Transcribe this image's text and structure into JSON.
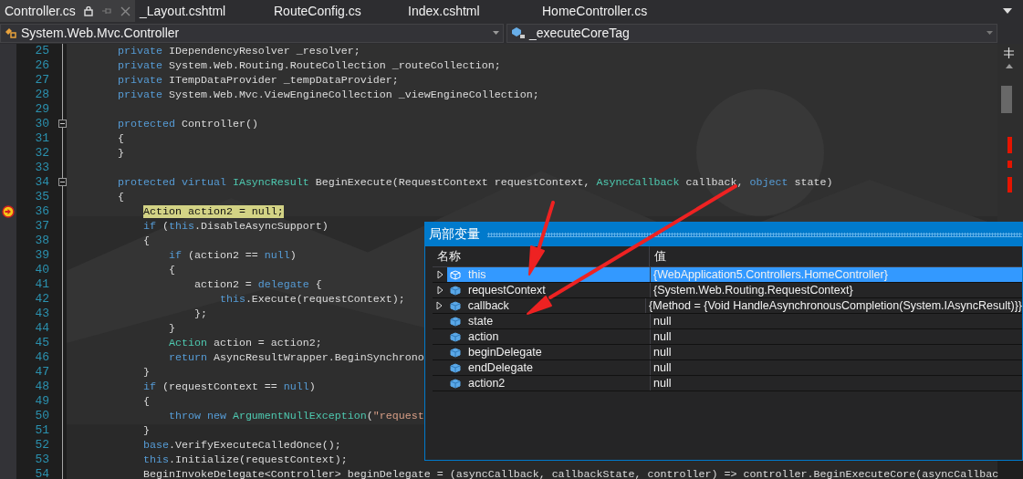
{
  "tabs": [
    {
      "label": "Controller.cs",
      "selected": true
    },
    {
      "label": "_Layout.cshtml",
      "selected": false
    },
    {
      "label": "RouteConfig.cs",
      "selected": false
    },
    {
      "label": "Index.cshtml",
      "selected": false
    },
    {
      "label": "HomeController.cs",
      "selected": false
    }
  ],
  "navigation": {
    "type_combo": "System.Web.Mvc.Controller",
    "member_combo": "_executeCoreTag"
  },
  "editor": {
    "lines": [
      {
        "number": "25",
        "tokens": [
          {
            "kind": "keyword",
            "text": "        private"
          },
          {
            "kind": "plain",
            "text": " IDependencyResolver _resolver;"
          }
        ]
      },
      {
        "number": "26",
        "tokens": [
          {
            "kind": "keyword",
            "text": "        private"
          },
          {
            "kind": "plain",
            "text": " System.Web.Routing.RouteCollection _routeCollection;"
          }
        ]
      },
      {
        "number": "27",
        "tokens": [
          {
            "kind": "keyword",
            "text": "        private"
          },
          {
            "kind": "plain",
            "text": " ITempDataProvider _tempDataProvider;"
          }
        ]
      },
      {
        "number": "28",
        "tokens": [
          {
            "kind": "keyword",
            "text": "        private"
          },
          {
            "kind": "plain",
            "text": " System.Web.Mvc.ViewEngineCollection _viewEngineCollection;"
          }
        ]
      },
      {
        "number": "29"
      },
      {
        "number": "30",
        "expanded": true,
        "tokens": [
          {
            "kind": "keyword",
            "text": "        protected"
          },
          {
            "kind": "plain",
            "text": " Controller()"
          }
        ]
      },
      {
        "number": "31",
        "tokens": [
          {
            "kind": "plain",
            "text": "        {"
          }
        ]
      },
      {
        "number": "32",
        "tokens": [
          {
            "kind": "plain",
            "text": "        }"
          }
        ]
      },
      {
        "number": "33"
      },
      {
        "number": "34",
        "expanded": true,
        "tokens": [
          {
            "kind": "keyword",
            "text": "        protected virtual"
          },
          {
            "kind": "type",
            "text": " IAsyncResult"
          },
          {
            "kind": "plain",
            "text": " BeginExecute(RequestContext requestContext, "
          },
          {
            "kind": "type",
            "text": "AsyncCallback"
          },
          {
            "kind": "plain",
            "text": " callback, "
          },
          {
            "kind": "keyword",
            "text": "object"
          },
          {
            "kind": "plain",
            "text": " state)"
          }
        ]
      },
      {
        "number": "35",
        "tokens": [
          {
            "kind": "plain",
            "text": "        {"
          }
        ]
      },
      {
        "number": "36",
        "current": true,
        "tokens": [
          {
            "kind": "plain",
            "text": "            Action action2 = null;"
          }
        ]
      },
      {
        "number": "37",
        "tokens": [
          {
            "kind": "keyword",
            "text": "            if"
          },
          {
            "kind": "plain",
            "text": " ("
          },
          {
            "kind": "keyword",
            "text": "this"
          },
          {
            "kind": "plain",
            "text": ".DisableAsyncSupport)"
          }
        ]
      },
      {
        "number": "38",
        "tokens": [
          {
            "kind": "plain",
            "text": "            {"
          }
        ]
      },
      {
        "number": "39",
        "tokens": [
          {
            "kind": "keyword",
            "text": "                if"
          },
          {
            "kind": "plain",
            "text": " (action2 == "
          },
          {
            "kind": "keyword",
            "text": "null"
          },
          {
            "kind": "plain",
            "text": ")"
          }
        ]
      },
      {
        "number": "40",
        "tokens": [
          {
            "kind": "plain",
            "text": "                {"
          }
        ]
      },
      {
        "number": "41",
        "tokens": [
          {
            "kind": "plain",
            "text": "                    action2 = "
          },
          {
            "kind": "keyword",
            "text": "delegate"
          },
          {
            "kind": "plain",
            "text": " {"
          }
        ]
      },
      {
        "number": "42",
        "tokens": [
          {
            "kind": "keyword",
            "text": "                        this"
          },
          {
            "kind": "plain",
            "text": ".Execute(requestContext);"
          }
        ]
      },
      {
        "number": "43",
        "tokens": [
          {
            "kind": "plain",
            "text": "                    };"
          }
        ]
      },
      {
        "number": "44",
        "tokens": [
          {
            "kind": "plain",
            "text": "                }"
          }
        ]
      },
      {
        "number": "45",
        "tokens": [
          {
            "kind": "type",
            "text": "                Action"
          },
          {
            "kind": "plain",
            "text": " action = action2;"
          }
        ]
      },
      {
        "number": "46",
        "tokens": [
          {
            "kind": "keyword",
            "text": "                return"
          },
          {
            "kind": "plain",
            "text": " AsyncResultWrapper.BeginSynchrono"
          }
        ]
      },
      {
        "number": "47",
        "tokens": [
          {
            "kind": "plain",
            "text": "            }"
          }
        ]
      },
      {
        "number": "48",
        "tokens": [
          {
            "kind": "keyword",
            "text": "            if"
          },
          {
            "kind": "plain",
            "text": " (requestContext == "
          },
          {
            "kind": "keyword",
            "text": "null"
          },
          {
            "kind": "plain",
            "text": ")"
          }
        ]
      },
      {
        "number": "49",
        "tokens": [
          {
            "kind": "plain",
            "text": "            {"
          }
        ]
      },
      {
        "number": "50",
        "tokens": [
          {
            "kind": "keyword",
            "text": "                throw new"
          },
          {
            "kind": "type",
            "text": " ArgumentNullException"
          },
          {
            "kind": "plain",
            "text": "("
          },
          {
            "kind": "string",
            "text": "\"request"
          }
        ]
      },
      {
        "number": "51",
        "tokens": [
          {
            "kind": "plain",
            "text": "            }"
          }
        ]
      },
      {
        "number": "52",
        "tokens": [
          {
            "kind": "keyword",
            "text": "            base"
          },
          {
            "kind": "plain",
            "text": ".VerifyExecuteCalledOnce();"
          }
        ]
      },
      {
        "number": "53",
        "tokens": [
          {
            "kind": "keyword",
            "text": "            this"
          },
          {
            "kind": "plain",
            "text": ".Initialize(requestContext);"
          }
        ]
      },
      {
        "number": "54",
        "tokens": [
          {
            "kind": "plain",
            "text": "            BeginInvokeDelegate<Controller> beginDelegate = (asyncCallback, callbackState, controller) => controller.BeginExecuteCore(asyncCallbac"
          }
        ]
      }
    ]
  },
  "locals": {
    "title": "局部变量",
    "columns": [
      "名称",
      "值"
    ],
    "rows": [
      {
        "name": "this",
        "value": "{WebApplication5.Controllers.HomeController}",
        "expandable": true,
        "selected": true
      },
      {
        "name": "requestContext",
        "value": "{System.Web.Routing.RequestContext}",
        "expandable": true,
        "selected": false
      },
      {
        "name": "callback",
        "value": "{Method = {Void HandleAsynchronousCompletion(System.IAsyncResult)}}",
        "expandable": true,
        "selected": false
      },
      {
        "name": "state",
        "value": "null",
        "expandable": false,
        "selected": false
      },
      {
        "name": "action",
        "value": "null",
        "expandable": false,
        "selected": false
      },
      {
        "name": "beginDelegate",
        "value": "null",
        "expandable": false,
        "selected": false
      },
      {
        "name": "endDelegate",
        "value": "null",
        "expandable": false,
        "selected": false
      },
      {
        "name": "action2",
        "value": "null",
        "expandable": false,
        "selected": false
      }
    ]
  }
}
